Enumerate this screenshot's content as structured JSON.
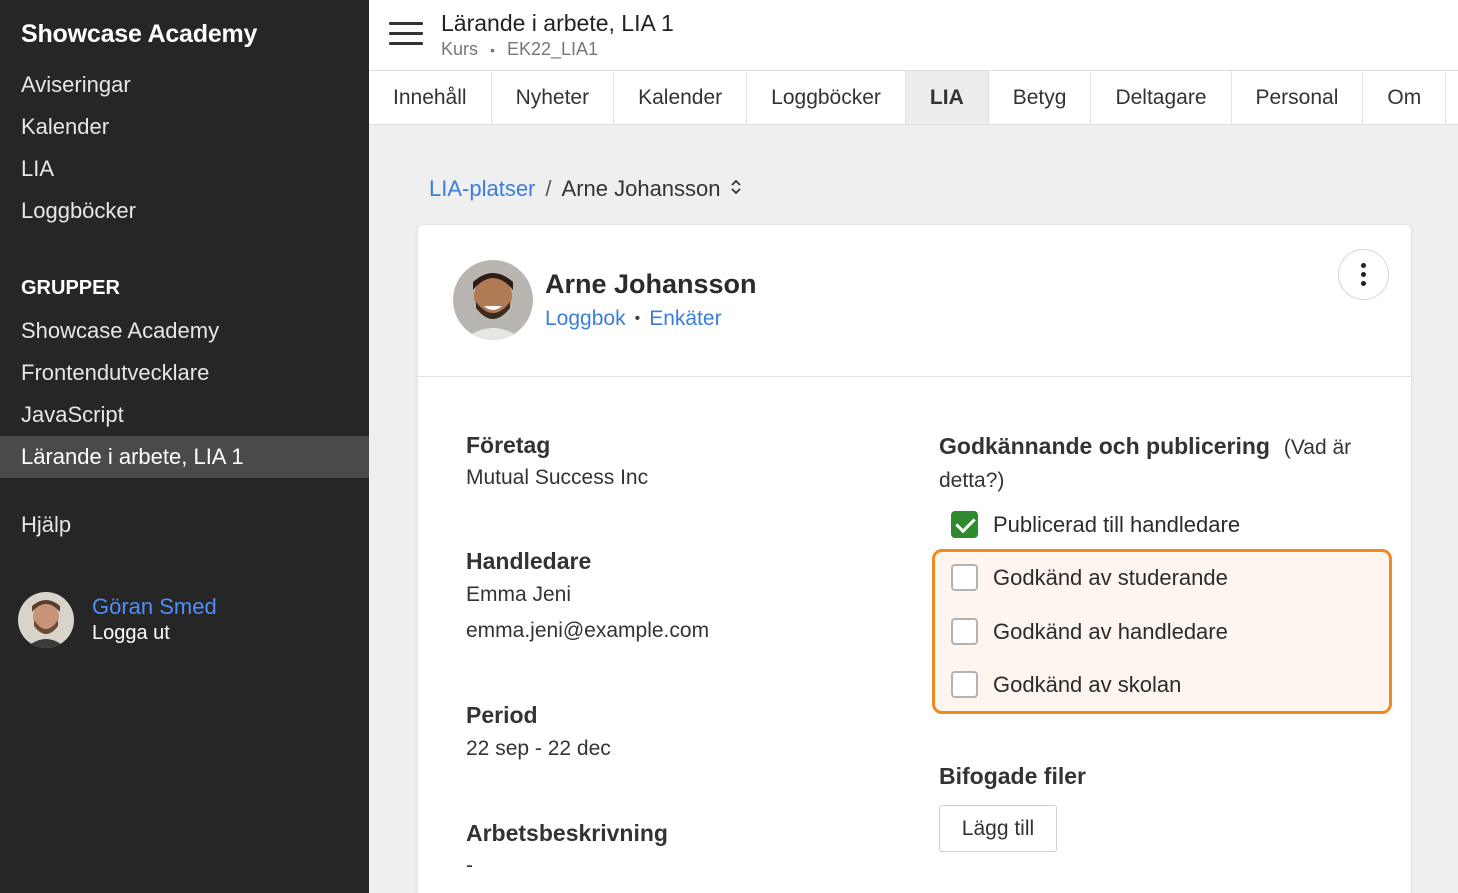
{
  "sidebar": {
    "brand": "Showcase Academy",
    "nav": [
      {
        "label": "Aviseringar"
      },
      {
        "label": "Kalender"
      },
      {
        "label": "LIA"
      },
      {
        "label": "Loggböcker"
      }
    ],
    "groups_heading": "GRUPPER",
    "groups": [
      {
        "label": "Showcase Academy"
      },
      {
        "label": "Frontendutvecklare"
      },
      {
        "label": "JavaScript"
      },
      {
        "label": "Lärande i arbete, LIA 1"
      }
    ],
    "help": "Hjälp",
    "user": {
      "name": "Göran Smed",
      "logout": "Logga ut"
    }
  },
  "header": {
    "title": "Lärande i arbete, LIA 1",
    "subtitle_type": "Kurs",
    "subtitle_sep": "•",
    "subtitle_code": "EK22_LIA1"
  },
  "tabs": [
    {
      "label": "Innehåll"
    },
    {
      "label": "Nyheter"
    },
    {
      "label": "Kalender"
    },
    {
      "label": "Loggböcker"
    },
    {
      "label": "LIA"
    },
    {
      "label": "Betyg"
    },
    {
      "label": "Deltagare"
    },
    {
      "label": "Personal"
    },
    {
      "label": "Om"
    }
  ],
  "active_tab": "LIA",
  "breadcrumb": {
    "parent": "LIA-platser",
    "sep": "/",
    "current": "Arne Johansson",
    "chevron": "⌃⌄"
  },
  "person": {
    "name": "Arne Johansson",
    "link_logbook": "Loggbok",
    "link_sep": "•",
    "link_surveys": "Enkäter"
  },
  "details": {
    "company_label": "Företag",
    "company_value": "Mutual Success Inc",
    "supervisor_label": "Handledare",
    "supervisor_name": "Emma Jeni",
    "supervisor_email": "emma.jeni@example.com",
    "period_label": "Period",
    "period_value": "22 sep - 22 dec",
    "description_label": "Arbetsbeskrivning",
    "description_value": "-"
  },
  "approval": {
    "title": "Godkännande och publicering",
    "help": "(Vad är detta?)",
    "items": [
      {
        "label": "Publicerad till handledare",
        "checked": true
      },
      {
        "label": "Godkänd av studerande",
        "checked": false
      },
      {
        "label": "Godkänd av handledare",
        "checked": false
      },
      {
        "label": "Godkänd av skolan",
        "checked": false
      }
    ]
  },
  "files": {
    "label": "Bifogade filer",
    "add_button": "Lägg till"
  },
  "colors": {
    "accent_link": "#3b7ddd",
    "highlight_border": "#ef8a22",
    "check_green": "#2f8a2f",
    "sidebar_bg": "#262626"
  }
}
